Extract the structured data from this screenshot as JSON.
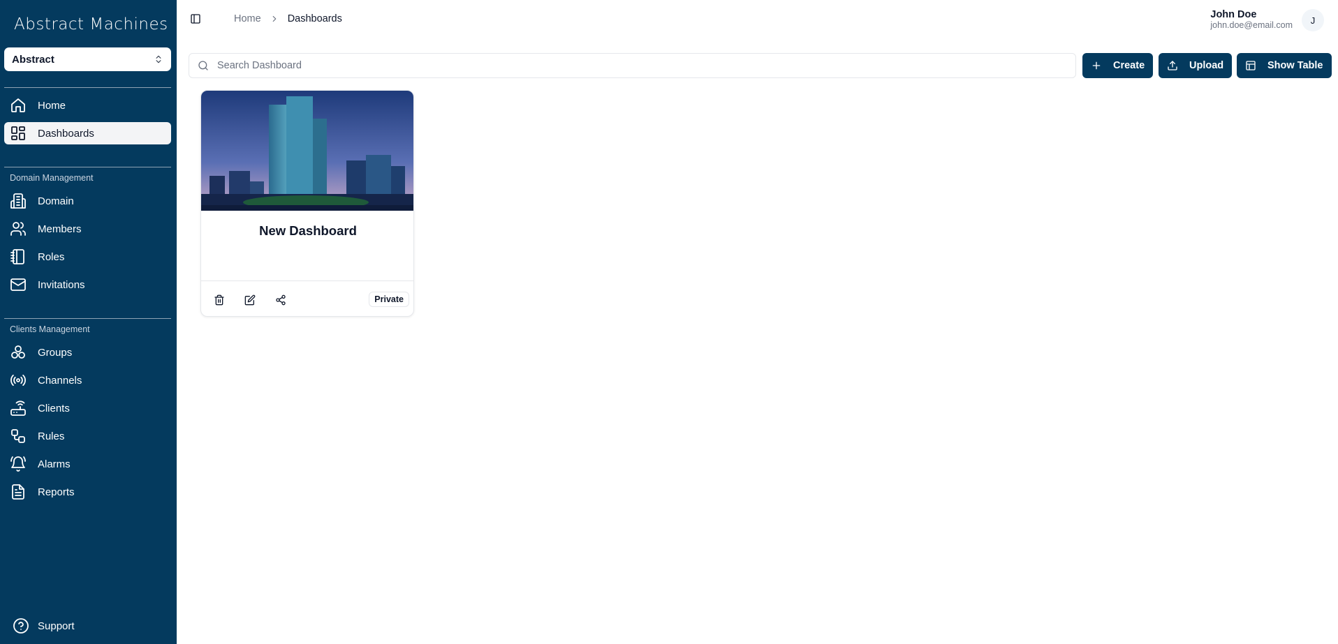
{
  "app": {
    "logo_text": "Abstract Machines"
  },
  "org_select": {
    "value": "Abstract"
  },
  "nav": {
    "primary": [
      {
        "label": "Home",
        "icon": "home-icon"
      },
      {
        "label": "Dashboards",
        "icon": "dashboard-icon",
        "active": true
      }
    ],
    "domain_section": {
      "label": "Domain Management",
      "items": [
        {
          "label": "Domain",
          "icon": "building-icon"
        },
        {
          "label": "Members",
          "icon": "users-icon"
        },
        {
          "label": "Roles",
          "icon": "notebook-icon"
        },
        {
          "label": "Invitations",
          "icon": "mail-icon"
        }
      ]
    },
    "clients_section": {
      "label": "Clients Management",
      "items": [
        {
          "label": "Groups",
          "icon": "groups-icon"
        },
        {
          "label": "Channels",
          "icon": "radio-icon"
        },
        {
          "label": "Clients",
          "icon": "router-icon"
        },
        {
          "label": "Rules",
          "icon": "workflow-icon"
        },
        {
          "label": "Alarms",
          "icon": "bell-ring-icon"
        },
        {
          "label": "Reports",
          "icon": "file-text-icon"
        }
      ]
    },
    "support_label": "Support"
  },
  "header": {
    "breadcrumb": {
      "home": "Home",
      "current": "Dashboards"
    },
    "user": {
      "name": "John Doe",
      "email": "john.doe@email.com",
      "avatar_initial": "J"
    }
  },
  "toolbar": {
    "search_placeholder": "Search Dashboard",
    "create_label": "Create",
    "upload_label": "Upload",
    "show_table_label": "Show Table"
  },
  "dashboards": [
    {
      "title": "New Dashboard",
      "visibility": "Private"
    }
  ],
  "colors": {
    "sidebar_bg": "#043a5e",
    "primary": "#043a5e"
  }
}
